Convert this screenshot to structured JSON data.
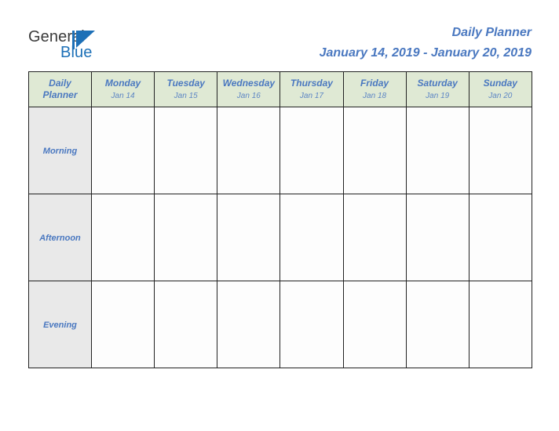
{
  "brand": {
    "name_part1": "General",
    "name_part2": "Blue",
    "mark": "triangle-logo-icon",
    "color_dark": "#3a3a3a",
    "color_blue": "#1d70b7"
  },
  "header": {
    "title": "Daily Planner",
    "date_range": "January 14, 2019 - January 20, 2019",
    "accent_color": "#4a78c0"
  },
  "table": {
    "corner": {
      "line1": "Daily",
      "line2": "Planner"
    },
    "header_bg": "#dfe9d4",
    "row_label_bg": "#e9e9e9",
    "cell_bg": "#fdfdfd",
    "border_color": "#222222",
    "columns": [
      {
        "day": "Monday",
        "date": "Jan 14"
      },
      {
        "day": "Tuesday",
        "date": "Jan 15"
      },
      {
        "day": "Wednesday",
        "date": "Jan 16"
      },
      {
        "day": "Thursday",
        "date": "Jan 17"
      },
      {
        "day": "Friday",
        "date": "Jan 18"
      },
      {
        "day": "Saturday",
        "date": "Jan 19"
      },
      {
        "day": "Sunday",
        "date": "Jan 20"
      }
    ],
    "rows": [
      {
        "label": "Morning",
        "cells": [
          "",
          "",
          "",
          "",
          "",
          "",
          ""
        ]
      },
      {
        "label": "Afternoon",
        "cells": [
          "",
          "",
          "",
          "",
          "",
          "",
          ""
        ]
      },
      {
        "label": "Evening",
        "cells": [
          "",
          "",
          "",
          "",
          "",
          "",
          ""
        ]
      }
    ]
  }
}
